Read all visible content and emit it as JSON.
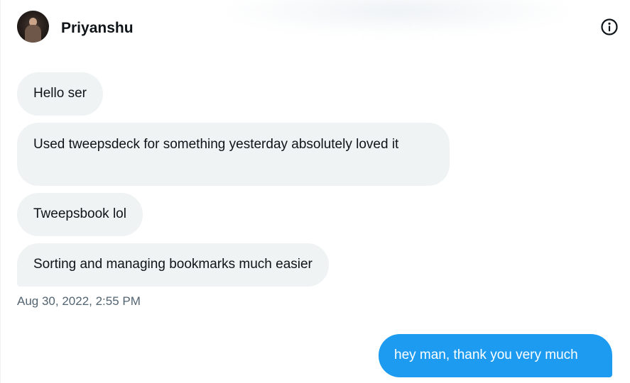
{
  "conversation": {
    "contact_name": "Priyanshu",
    "info_icon": "info-icon",
    "avatar": "profile-avatar"
  },
  "messages": {
    "incoming": [
      "Hello ser",
      "Used  tweepsdeck for something yesterday absolutely loved it",
      "Tweepsbook lol",
      "Sorting and managing bookmarks much easier"
    ],
    "incoming_timestamp": "Aug 30, 2022, 2:55 PM",
    "outgoing": [
      "hey man, thank you very much"
    ]
  },
  "colors": {
    "incoming_bubble": "#eff3f4",
    "outgoing_bubble": "#1d9bf0",
    "timestamp_text": "#536471"
  }
}
